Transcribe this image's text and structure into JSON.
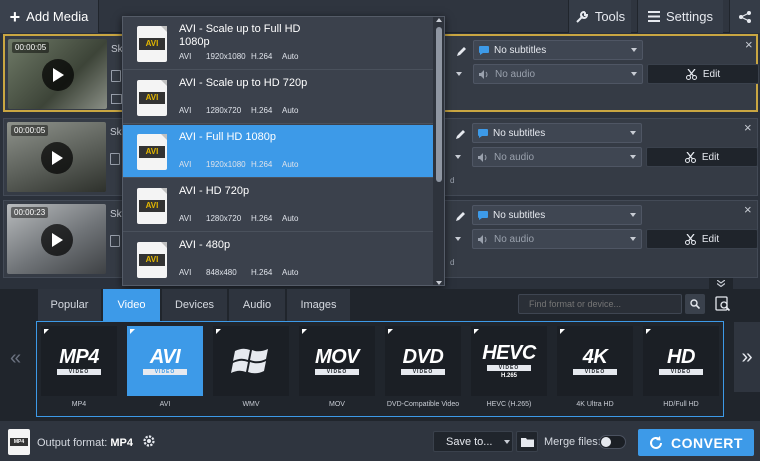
{
  "toolbar": {
    "add_media_label": "Add Media",
    "tools_label": "Tools",
    "settings_label": "Settings"
  },
  "files": [
    {
      "time": "00:00:05",
      "name": "Ska",
      "subtitles": "No subtitles",
      "audio": "No audio",
      "edit_label": "Edit",
      "selected": true
    },
    {
      "time": "00:00:05",
      "name": "Ska",
      "subtitles": "No subtitles",
      "audio": "No audio",
      "edit_label": "Edit",
      "selected": false
    },
    {
      "time": "00:00:23",
      "name": "Sky",
      "subtitles": "No subtitles",
      "audio": "No audio",
      "edit_label": "Edit",
      "selected": false
    }
  ],
  "presets": [
    {
      "title": "AVI - Scale up to Full HD 1080p",
      "fmt": "AVI",
      "res": "1920x1080",
      "codec": "H.264",
      "mode": "Auto",
      "icon": "AVI",
      "active": false
    },
    {
      "title": "AVI - Scale up to HD 720p",
      "fmt": "AVI",
      "res": "1280x720",
      "codec": "H.264",
      "mode": "Auto",
      "icon": "AVI",
      "active": false
    },
    {
      "title": "AVI - Full HD 1080p",
      "fmt": "AVI",
      "res": "1920x1080",
      "codec": "H.264",
      "mode": "Auto",
      "icon": "AVI",
      "active": true
    },
    {
      "title": "AVI - HD 720p",
      "fmt": "AVI",
      "res": "1280x720",
      "codec": "H.264",
      "mode": "Auto",
      "icon": "AVI",
      "active": false
    },
    {
      "title": "AVI - 480p",
      "fmt": "AVI",
      "res": "848x480",
      "codec": "H.264",
      "mode": "Auto",
      "icon": "AVI",
      "active": false
    }
  ],
  "tabs": [
    {
      "label": "Popular",
      "active": false
    },
    {
      "label": "Video",
      "active": true
    },
    {
      "label": "Devices",
      "active": false
    },
    {
      "label": "Audio",
      "active": false
    },
    {
      "label": "Images",
      "active": false
    }
  ],
  "search": {
    "placeholder": "Find format or device..."
  },
  "formats": [
    {
      "logo": "MP4",
      "bar": "VIDEO",
      "name": "MP4",
      "active": false
    },
    {
      "logo": "AVI",
      "bar": "VIDEO",
      "name": "AVI",
      "active": true
    },
    {
      "logo": "",
      "bar": "",
      "name": "WMV",
      "active": false
    },
    {
      "logo": "MOV",
      "bar": "VIDEO",
      "name": "MOV",
      "active": false
    },
    {
      "logo": "DVD",
      "bar": "VIDEO",
      "name": "DVD-Compatible Video",
      "active": false
    },
    {
      "logo": "HEVC",
      "bar": "VIDEO",
      "sub": "H.265",
      "name": "HEVC (H.265)",
      "active": false
    },
    {
      "logo": "4K",
      "bar": "VIDEO",
      "name": "4K Ultra HD",
      "active": false
    },
    {
      "logo": "HD",
      "bar": "VIDEO",
      "name": "HD/Full HD",
      "active": false
    }
  ],
  "bottom": {
    "output_prefix": "Output format:",
    "output_value": "MP4",
    "output_icon": "MP4",
    "save_to_label": "Save to...",
    "merge_label": "Merge files:",
    "convert_label": "CONVERT"
  },
  "colors": {
    "accent": "#3d9ae8",
    "selection": "#c9a642"
  }
}
